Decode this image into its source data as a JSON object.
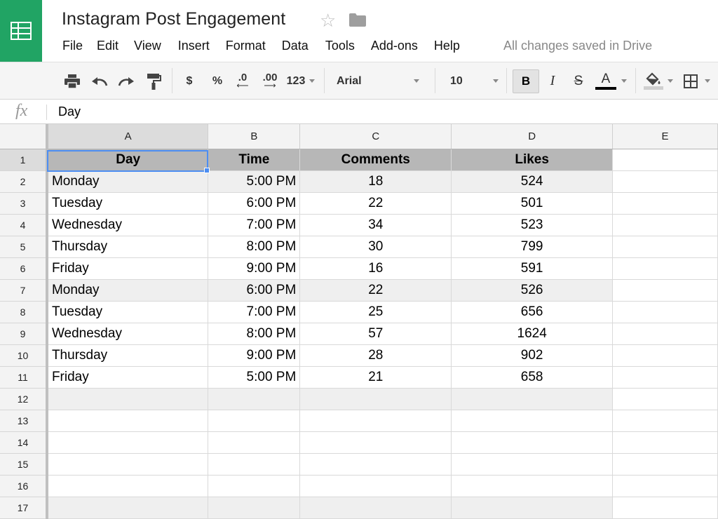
{
  "app": {
    "title": "Instagram Post Engagement",
    "saved_status": "All changes saved in Drive",
    "icons": [
      "sheets-logo-icon",
      "star-icon",
      "folder-icon"
    ]
  },
  "menu": [
    "File",
    "Edit",
    "View",
    "Insert",
    "Format",
    "Data",
    "Tools",
    "Add-ons",
    "Help"
  ],
  "toolbar": {
    "currency": "$",
    "percent": "%",
    "decrease_decimals": ".0",
    "increase_decimals": ".00",
    "more_formats": "123",
    "font": "Arial",
    "font_size": "10",
    "bold": "B",
    "italic": "I",
    "strikethrough": "S",
    "text_color_label": "A",
    "text_color": "#000000",
    "icons": [
      "print-icon",
      "undo-icon",
      "redo-icon",
      "paint-format-icon",
      "fill-color-icon",
      "borders-icon"
    ]
  },
  "formula_bar": {
    "fx": "fx",
    "value": "Day"
  },
  "columns": [
    "A",
    "B",
    "C",
    "D",
    "E"
  ],
  "row_numbers": [
    "1",
    "2",
    "3",
    "4",
    "5",
    "6",
    "7",
    "8",
    "9",
    "10",
    "11",
    "12",
    "13",
    "14",
    "15",
    "16",
    "17"
  ],
  "header_row": [
    "Day",
    "Time",
    "Comments",
    "Likes",
    ""
  ],
  "rows": [
    [
      "Monday",
      "5:00 PM",
      "18",
      "524",
      ""
    ],
    [
      "Tuesday",
      "6:00 PM",
      "22",
      "501",
      ""
    ],
    [
      "Wednesday",
      "7:00 PM",
      "34",
      "523",
      ""
    ],
    [
      "Thursday",
      "8:00 PM",
      "30",
      "799",
      ""
    ],
    [
      "Friday",
      "9:00 PM",
      "16",
      "591",
      ""
    ],
    [
      "Monday",
      "6:00 PM",
      "22",
      "526",
      ""
    ],
    [
      "Tuesday",
      "7:00 PM",
      "25",
      "656",
      ""
    ],
    [
      "Wednesday",
      "8:00 PM",
      "57",
      "1624",
      ""
    ],
    [
      "Thursday",
      "9:00 PM",
      "28",
      "902",
      ""
    ],
    [
      "Friday",
      "5:00 PM",
      "21",
      "658",
      ""
    ],
    [
      "",
      "",
      "",
      "",
      ""
    ],
    [
      "",
      "",
      "",
      "",
      ""
    ],
    [
      "",
      "",
      "",
      "",
      ""
    ],
    [
      "",
      "",
      "",
      "",
      ""
    ],
    [
      "",
      "",
      "",
      "",
      ""
    ],
    [
      "",
      "",
      "",
      "",
      ""
    ]
  ],
  "selected_cell": "A1",
  "colors": {
    "brand": "#21a464",
    "selection": "#4d8ef2",
    "header_fill": "#b7b7b7",
    "band_fill": "#efefef"
  }
}
